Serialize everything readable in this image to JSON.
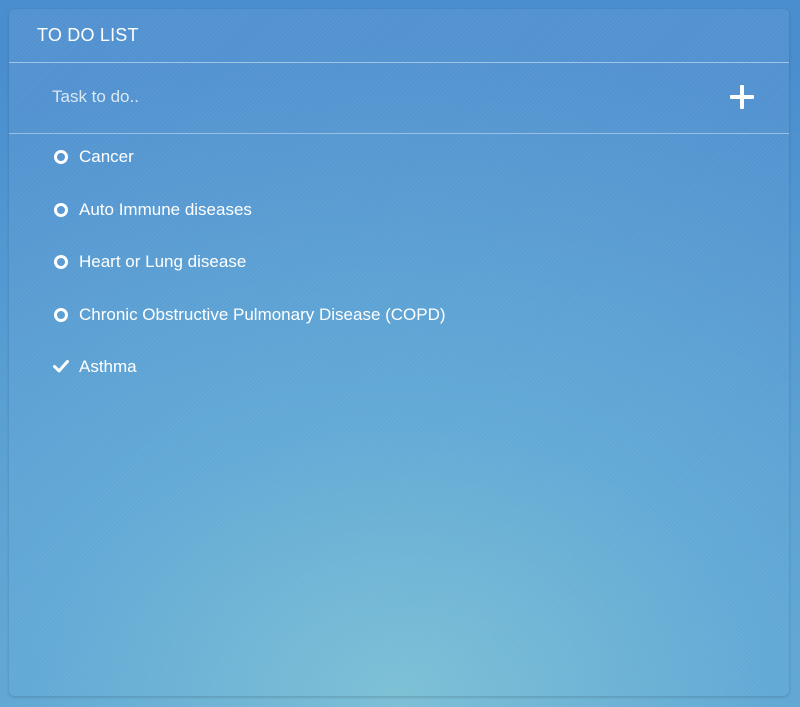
{
  "header": {
    "title": "TO DO LIST"
  },
  "new_task": {
    "placeholder": "Task to do..",
    "value": "",
    "add_icon": "plus-icon"
  },
  "tasks": [
    {
      "label": "Cancer",
      "done": false,
      "icon": "circle-icon"
    },
    {
      "label": "Auto Immune diseases",
      "done": false,
      "icon": "circle-icon"
    },
    {
      "label": "Heart or Lung disease",
      "done": false,
      "icon": "circle-icon"
    },
    {
      "label": "Chronic Obstructive Pulmonary Disease (COPD)",
      "done": false,
      "icon": "circle-icon"
    },
    {
      "label": "Asthma",
      "done": true,
      "icon": "check-icon"
    }
  ],
  "colors": {
    "background_top": "#4a8ecf",
    "background_bottom": "#7dbfd6",
    "text": "#ffffff"
  }
}
